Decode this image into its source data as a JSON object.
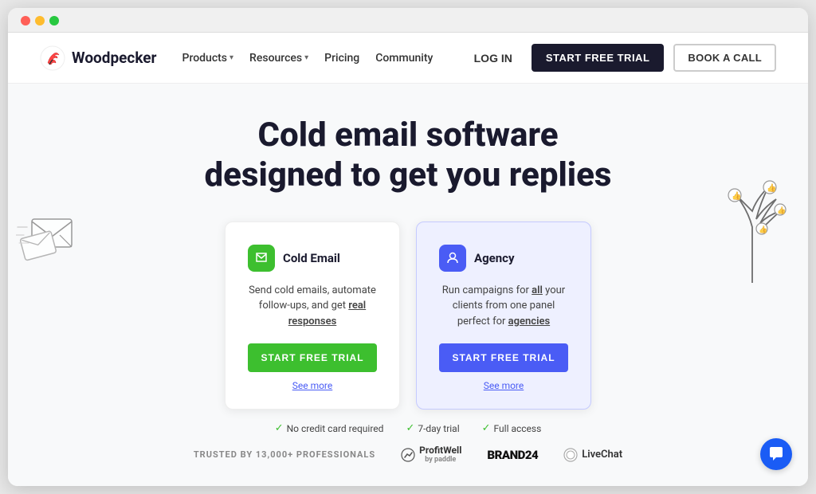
{
  "browser": {
    "dots": [
      "red",
      "yellow",
      "green"
    ]
  },
  "navbar": {
    "logo_text": "Woodpecker",
    "nav_items": [
      {
        "label": "Products",
        "has_dropdown": true
      },
      {
        "label": "Resources",
        "has_dropdown": true
      },
      {
        "label": "Pricing",
        "has_dropdown": false
      },
      {
        "label": "Community",
        "has_dropdown": false
      }
    ],
    "login_label": "LOG IN",
    "start_trial_label": "START FREE TRIAL",
    "book_call_label": "BOOK A CALL"
  },
  "hero": {
    "title_line1": "Cold email software",
    "title_line2": "designed to get you replies"
  },
  "cards": [
    {
      "id": "cold-email",
      "title": "Cold Email",
      "icon_color": "green",
      "description_parts": [
        "Send cold emails, automate follow-ups, and get ",
        "real",
        " responses"
      ],
      "cta_label": "START FREE TRIAL",
      "see_more_label": "See more",
      "variant": "default"
    },
    {
      "id": "agency",
      "title": "Agency",
      "icon_color": "blue",
      "description_parts": [
        "Run campaigns for ",
        "all",
        " your clients from one panel perfect for ",
        "agencies"
      ],
      "cta_label": "START FREE TRIAL",
      "see_more_label": "See more",
      "variant": "agency"
    }
  ],
  "trust_items": [
    {
      "label": "No credit card required"
    },
    {
      "label": "7-day trial"
    },
    {
      "label": "Full access"
    }
  ],
  "bottom_bar": {
    "trusted_text": "TRUSTED BY 13,000+ PROFESSIONALS",
    "brands": [
      {
        "name": "ProfitWell",
        "sub": "by paddle"
      },
      {
        "name": "BRAND24"
      },
      {
        "name": "LiveChat"
      }
    ]
  }
}
